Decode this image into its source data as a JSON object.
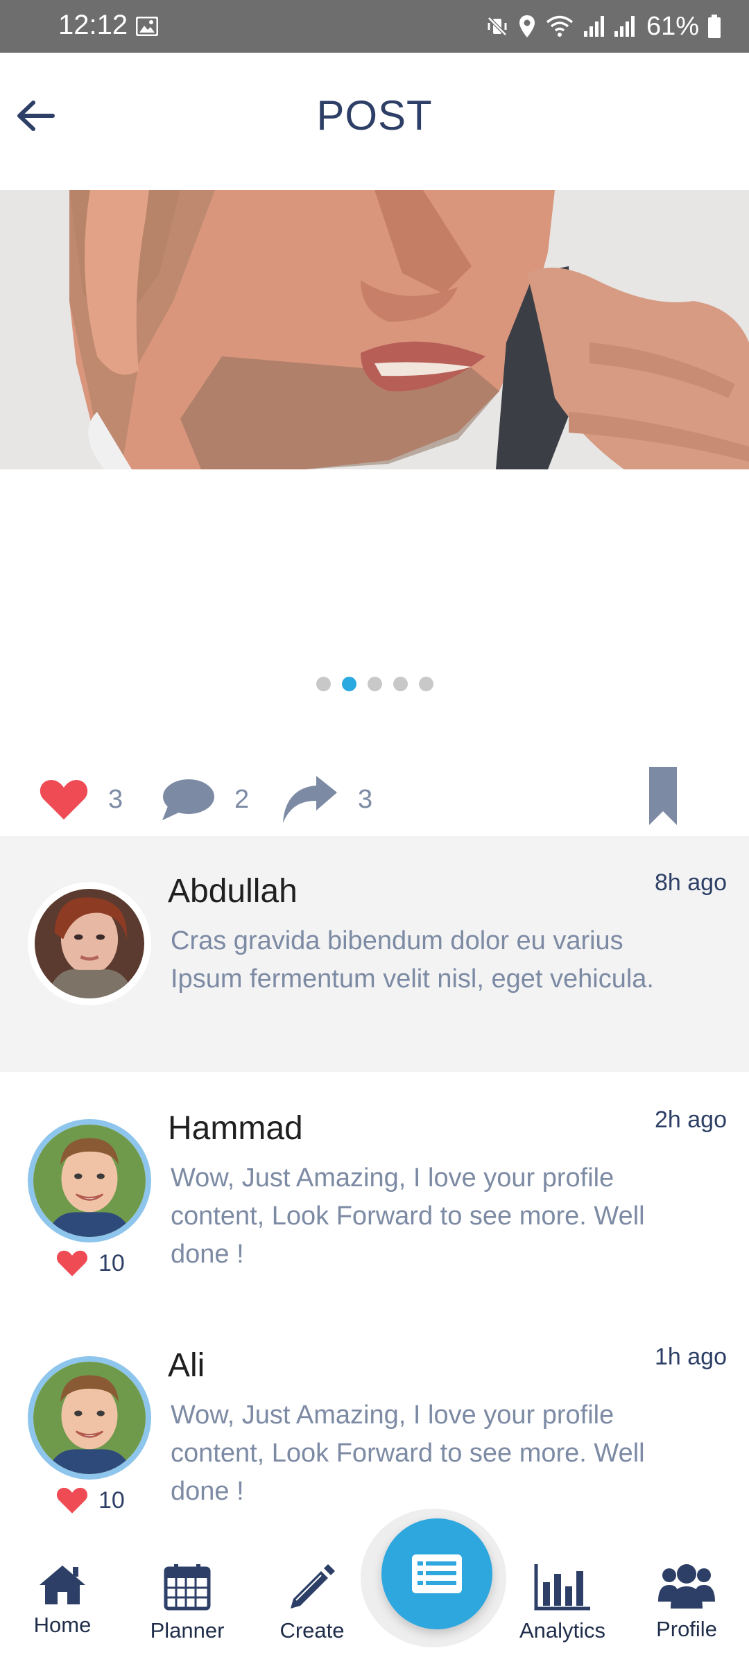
{
  "status_bar": {
    "time": "12:12",
    "battery": "61%"
  },
  "header": {
    "title": "POST"
  },
  "carousel": {
    "count": 5,
    "active_index": 1
  },
  "actions": {
    "likes": "3",
    "comments": "2",
    "shares": "3"
  },
  "comments": [
    {
      "author": "Abdullah",
      "time": "8h ago",
      "text": "Cras gravida bibendum dolor eu varius Ipsum fermentum velit nisl, eget vehicula."
    },
    {
      "author": "Hammad",
      "time": "2h ago",
      "text": "Wow, Just Amazing, I love your profile content, Look Forward to see more. Well done !",
      "likes": "10"
    },
    {
      "author": "Ali",
      "time": "1h ago",
      "text": "Wow, Just Amazing, I love your profile content, Look Forward to see more. Well done !",
      "likes": "10"
    }
  ],
  "nav": {
    "home": "Home",
    "planner": "Planner",
    "create": "Create",
    "analytics": "Analytics",
    "profile": "Profile"
  },
  "colors": {
    "accent": "#2ea7df",
    "heart": "#ef4b55",
    "navy": "#2d3f66",
    "muted": "#7c8aa4"
  }
}
